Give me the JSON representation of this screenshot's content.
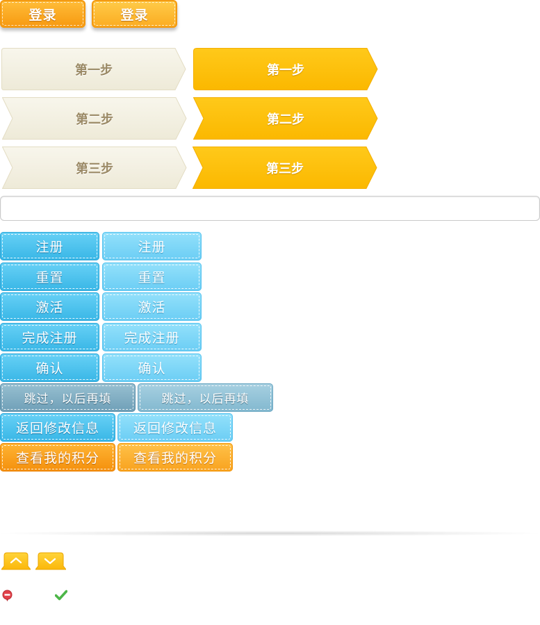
{
  "login_buttons": [
    "登录",
    "登录"
  ],
  "steps": {
    "inactive": [
      "第一步",
      "第二步",
      "第三步"
    ],
    "active": [
      "第一步",
      "第二步",
      "第三步"
    ]
  },
  "input": {
    "value": "",
    "placeholder": ""
  },
  "buttons": {
    "register": [
      "注册",
      "注册"
    ],
    "reset": [
      "重置",
      "重置"
    ],
    "activate": [
      "激活",
      "激活"
    ],
    "complete": [
      "完成注册",
      "完成注册"
    ],
    "confirm": [
      "确认",
      "确认"
    ],
    "skip": [
      "跳过，以后再填",
      "跳过，以后再填"
    ],
    "back": [
      "返回修改信息",
      "返回修改信息"
    ],
    "points": [
      "查看我的积分",
      "查看我的积分"
    ]
  },
  "arrows": {
    "up_icon": "chevron-up-icon",
    "down_icon": "chevron-down-icon"
  },
  "status_icons": {
    "error": "error-icon",
    "success": "check-icon"
  },
  "colors": {
    "orange": "#f7980f",
    "gold": "#fdc10c",
    "beige": "#f4f1e4",
    "blue": "#38b6e6",
    "light_blue": "#6bcdf4",
    "gray_blue": "#6e9fb7",
    "error_red": "#e2424a",
    "success_green": "#4cb648"
  }
}
